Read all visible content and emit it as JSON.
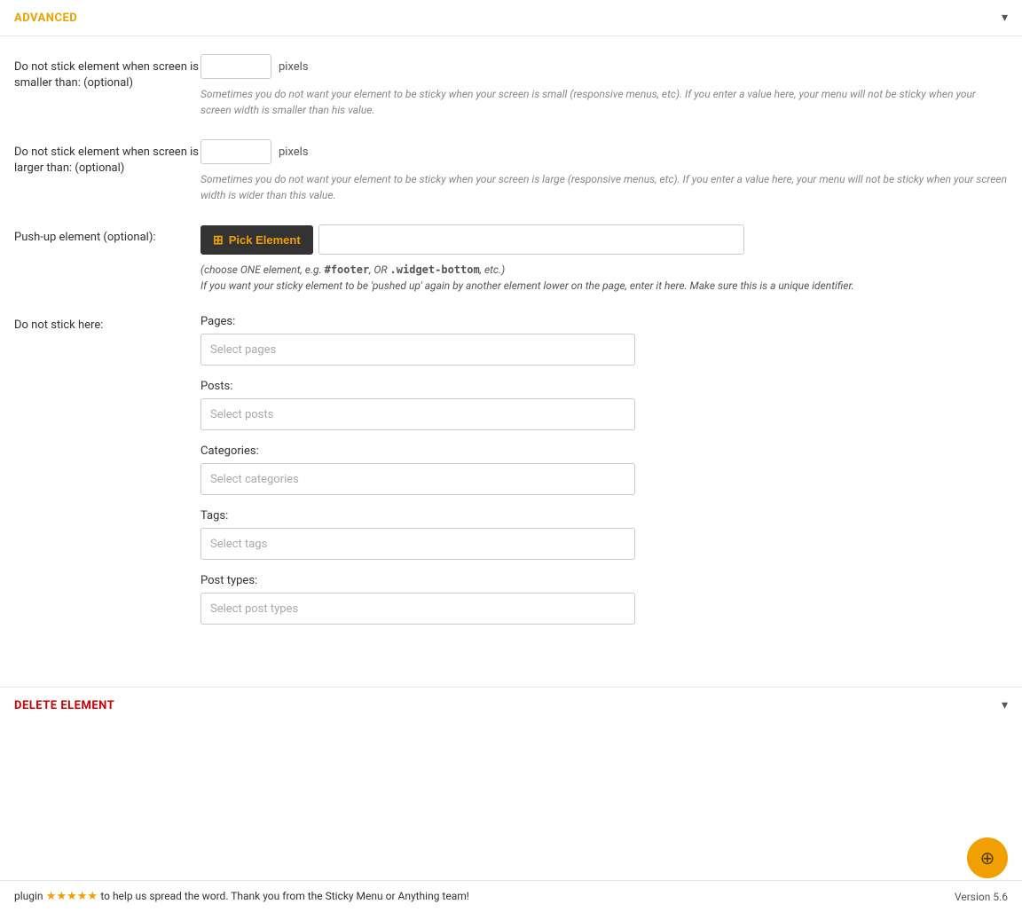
{
  "advanced": {
    "title": "ADVANCED",
    "chevron": "▾"
  },
  "form": {
    "min_screen": {
      "label": "Do not stick element when screen is smaller than: (optional)",
      "placeholder": "",
      "unit": "pixels",
      "help": "Sometimes you do not want your element to be sticky when your screen is small (responsive menus, etc). If you enter a value here, your menu will not be sticky when your screen width is smaller than his value."
    },
    "max_screen": {
      "label": "Do not stick element when screen is larger than: (optional)",
      "placeholder": "",
      "unit": "pixels",
      "help": "Sometimes you do not want your element to be sticky when your screen is large (responsive menus, etc). If you enter a value here, your menu will not be sticky when your screen width is wider than this value."
    },
    "push_up": {
      "label": "Push-up element (optional):",
      "btn_label": "Pick Element",
      "hint_line1": "(choose ONE element, e.g. #footer, OR .widget-bottom, etc.)",
      "hint_line2": "If you want your sticky element to be 'pushed up' again by another element lower on the page, enter it here. Make sure this is a unique identifier.",
      "hint_bold1": "#footer",
      "hint_bold2": ".widget-bottom"
    },
    "do_not_stick": {
      "label": "Do not stick here:",
      "pages_label": "Pages:",
      "pages_placeholder": "Select pages",
      "posts_label": "Posts:",
      "posts_placeholder": "Select posts",
      "categories_label": "Categories:",
      "categories_placeholder": "Select categories",
      "tags_label": "Tags:",
      "tags_placeholder": "Select tags",
      "post_types_label": "Post types:",
      "post_types_placeholder": "Select post types"
    }
  },
  "delete": {
    "label": "DELETE ELEMENT"
  },
  "footer": {
    "plugin_text": "plugin",
    "stars": "★★★★★",
    "help_text": "to help us spread the word. Thank you from the Sticky Menu or Anything team!",
    "version": "Version 5.6"
  }
}
